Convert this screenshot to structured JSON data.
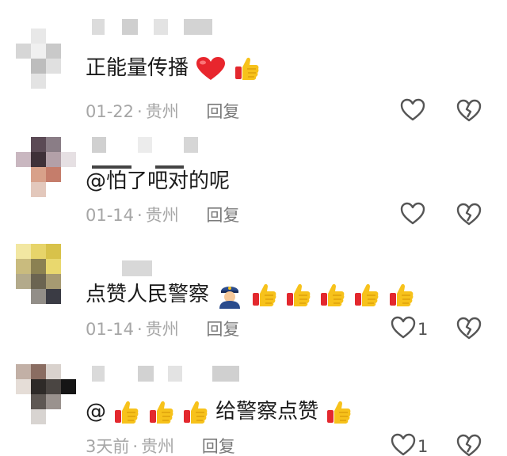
{
  "colors": {
    "text": "#1a1a1a",
    "meta": "#a6a6a6",
    "reply": "#7a7a7a",
    "icon": "#555555"
  },
  "comments": [
    {
      "text": "正能量传播",
      "emojis": [
        "red-heart-icon",
        "thumbs-up-icon"
      ],
      "date": "01-22",
      "location": "贵州",
      "reply_label": "回复",
      "like_count": ""
    },
    {
      "text": "@怕了吧对的呢",
      "emojis": [],
      "date": "01-14",
      "location": "贵州",
      "reply_label": "回复",
      "like_count": ""
    },
    {
      "text": "点赞人民警察",
      "emojis": [
        "police-officer-icon",
        "thumbs-up-icon",
        "thumbs-up-icon",
        "thumbs-up-icon",
        "thumbs-up-icon",
        "thumbs-up-icon"
      ],
      "date": "01-14",
      "location": "贵州",
      "reply_label": "回复",
      "like_count": "1"
    },
    {
      "text_prefix": "@",
      "prefix_emojis": [
        "thumbs-up-icon",
        "thumbs-up-icon",
        "thumbs-up-icon"
      ],
      "text": "给警察点赞",
      "emojis": [
        "thumbs-up-icon"
      ],
      "date": "3天前",
      "location": "贵州",
      "reply_label": "回复",
      "like_count": "1"
    }
  ]
}
